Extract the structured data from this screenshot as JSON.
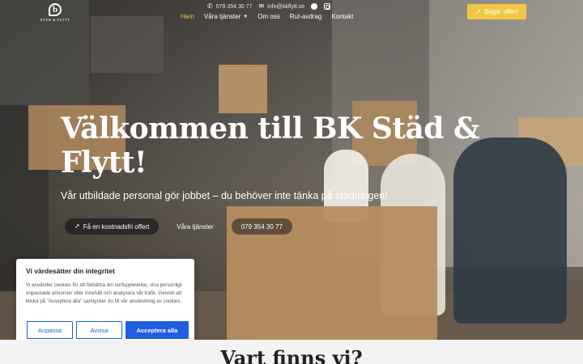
{
  "header": {
    "logo_letter": "b",
    "logo_text": "STÄD & FLYTT",
    "phone": "079 354 30 77",
    "email": "info@bkflytt.se",
    "nav": [
      {
        "label": "Hem",
        "active": true
      },
      {
        "label": "Våra tjänster",
        "has_dropdown": true
      },
      {
        "label": "Om oss"
      },
      {
        "label": "Rut-avdrag"
      },
      {
        "label": "Kontakt"
      }
    ],
    "cta": "Begär offert"
  },
  "hero": {
    "title": "Välkommen till BK Städ & Flytt!",
    "subtitle": "Vår utbildade personal gör jobbet – du behöver inte tänka på städningen!",
    "buttons": [
      {
        "label": "Få en kostnadsfri offert",
        "icon": "rocket-icon"
      },
      {
        "label": "Våra tjänster"
      },
      {
        "label": "079 354 30 77"
      }
    ]
  },
  "cookie": {
    "title": "Vi värdesätter din integritet",
    "text": "Vi använder cookies för att förbättra din surfupplevelse, visa personligt anpassade annonser eller innehåll och analysera vår trafik. Genom att klicka på \"Acceptera alla\" samtycker du till vår användning av cookies.",
    "buttons": {
      "customize": "Anpassa",
      "reject": "Avvisa",
      "accept": "Acceptera alla"
    }
  },
  "section": {
    "title": "Vart finns vi?"
  },
  "colors": {
    "accent": "#f2c744",
    "cookie_blue": "#1f5ee0"
  }
}
